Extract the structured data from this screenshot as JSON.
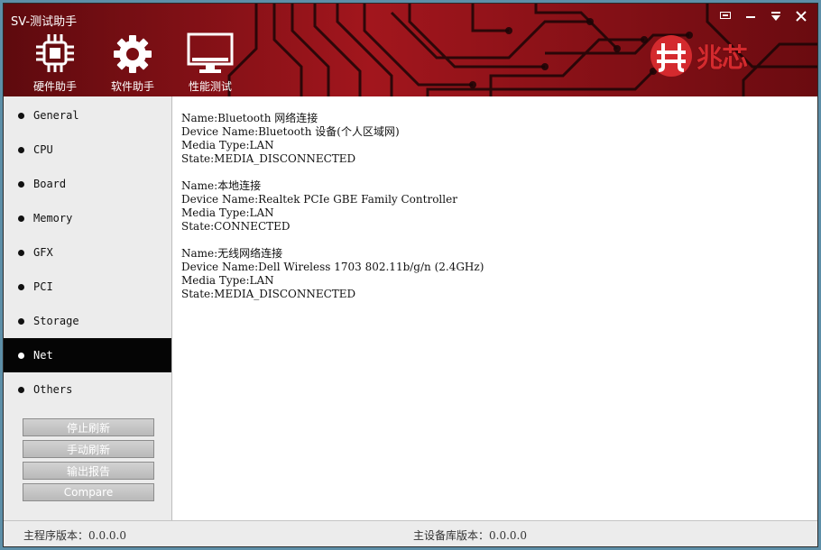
{
  "window": {
    "title": "SV-测试助手",
    "controls": [
      {
        "name": "feedback",
        "glyph": "▪"
      },
      {
        "name": "minimize",
        "glyph": "—"
      },
      {
        "name": "menu",
        "glyph": "▼"
      },
      {
        "name": "close",
        "glyph": "✕"
      }
    ]
  },
  "toolbar": {
    "items": [
      {
        "label": "硬件助手",
        "icon": "chip-icon"
      },
      {
        "label": "软件助手",
        "icon": "gear-icon"
      },
      {
        "label": "性能测试",
        "icon": "monitor-icon"
      }
    ]
  },
  "brand": {
    "text": "兆芯",
    "accent": "#d42a2e"
  },
  "sidebar": {
    "items": [
      {
        "label": "General"
      },
      {
        "label": "CPU"
      },
      {
        "label": "Board"
      },
      {
        "label": "Memory"
      },
      {
        "label": "GFX"
      },
      {
        "label": "PCI"
      },
      {
        "label": "Storage"
      },
      {
        "label": "Net",
        "active": true
      },
      {
        "label": "Others"
      }
    ],
    "buttons": [
      {
        "label": "停止刷新"
      },
      {
        "label": "手动刷新"
      },
      {
        "label": "输出报告"
      },
      {
        "label": "Compare"
      }
    ]
  },
  "content": {
    "adapters": [
      {
        "lines": [
          "Name:Bluetooth 网络连接",
          "Device Name:Bluetooth 设备(个人区域网)",
          "Media Type:LAN",
          "State:MEDIA_DISCONNECTED"
        ]
      },
      {
        "lines": [
          "Name:本地连接",
          "Device Name:Realtek PCIe GBE Family Controller",
          "Media Type:LAN",
          "State:CONNECTED"
        ]
      },
      {
        "lines": [
          "Name:无线网络连接",
          "Device Name:Dell Wireless 1703 802.11b/g/n (2.4GHz)",
          "Media Type:LAN",
          "State:MEDIA_DISCONNECTED"
        ]
      }
    ]
  },
  "status": {
    "main_version": "主程序版本：0.0.0.0",
    "db_version": "主设备库版本：0.0.0.0"
  },
  "colors": {
    "header_red": "#7a0d12",
    "active_nav": "#050505"
  }
}
